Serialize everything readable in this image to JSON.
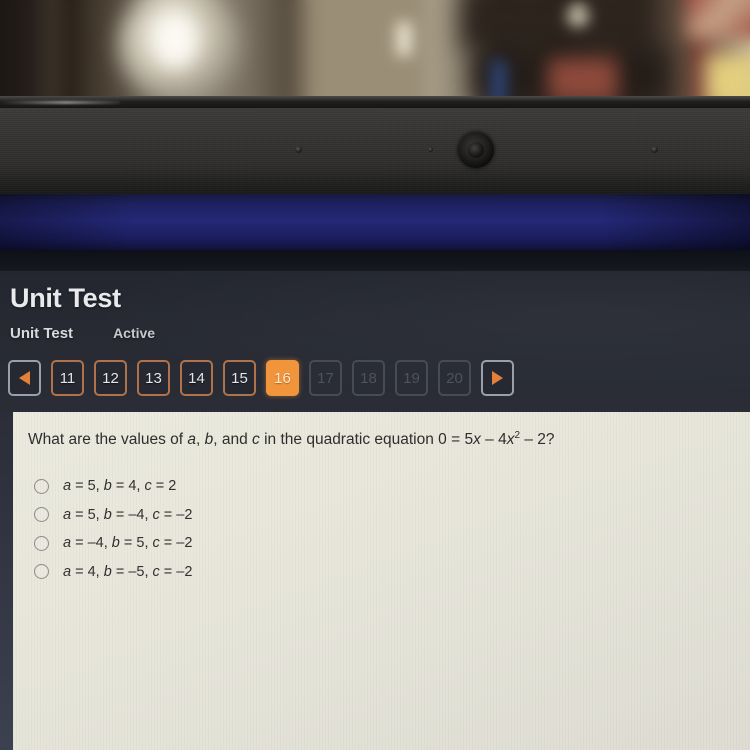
{
  "photo": {
    "description": "blurred room background above laptop lid",
    "objects": [
      "lamp",
      "wall",
      "light-switch",
      "bookshelf",
      "wall-art"
    ]
  },
  "device": {
    "bezel": "laptop-screen-bezel",
    "webcam": "webcam-lens",
    "indicator_dots": 3
  },
  "header": {
    "title": "Unit Test",
    "sub_label": "Unit Test",
    "status": "Active"
  },
  "pager": {
    "prev_icon": "triangle-left-icon",
    "next_icon": "triangle-right-icon",
    "items": [
      {
        "label": "11",
        "state": "enabled"
      },
      {
        "label": "12",
        "state": "enabled"
      },
      {
        "label": "13",
        "state": "enabled"
      },
      {
        "label": "14",
        "state": "enabled"
      },
      {
        "label": "15",
        "state": "enabled"
      },
      {
        "label": "16",
        "state": "active"
      },
      {
        "label": "17",
        "state": "disabled"
      },
      {
        "label": "18",
        "state": "disabled"
      },
      {
        "label": "19",
        "state": "disabled"
      },
      {
        "label": "20",
        "state": "disabled"
      }
    ],
    "active_label": "16"
  },
  "question": {
    "prefix": "What are the values of ",
    "var_a": "a",
    "sep1": ", ",
    "var_b": "b",
    "sep2": ", and ",
    "var_c": "c",
    "middle": " in the quadratic equation 0 = 5",
    "var_x1": "x",
    "op1": " – 4",
    "var_x2": "x",
    "exp": "2",
    "tail": " – 2?",
    "full_text": "What are the values of a, b, and c in the quadratic equation 0 = 5x – 4x2 – 2?"
  },
  "options": [
    {
      "text": "a = 5, b = 4, c = 2",
      "selected": false
    },
    {
      "text": "a = 5, b = –4, c = –2",
      "selected": false
    },
    {
      "text": "a = –4, b = 5, c = –2",
      "selected": false
    },
    {
      "text": "a = 4, b = –5, c = –2",
      "selected": false
    }
  ],
  "colors": {
    "accent_orange": "#f0953c",
    "header_dark": "#2a2d36",
    "panel_bg": "#e9e7db",
    "chrome_blue": "#242877",
    "disabled_gray": "#4e525d"
  }
}
